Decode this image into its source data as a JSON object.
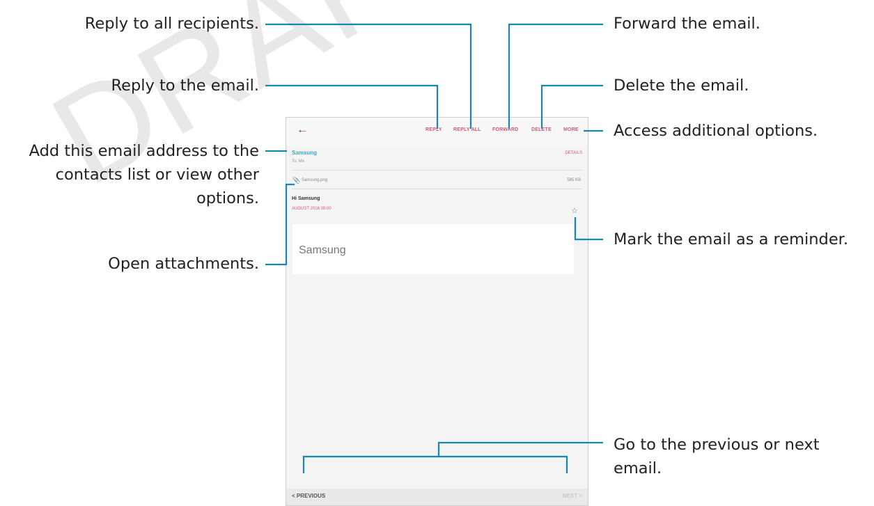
{
  "watermark": "DRAFT",
  "callouts": {
    "reply_all": "Reply to all recipients.",
    "reply": "Reply to the email.",
    "contact_line1": "Add this email address to the",
    "contact_line2": "contacts list or view other",
    "contact_line3": "options.",
    "attachments": "Open attachments.",
    "forward": "Forward the email.",
    "delete": "Delete the email.",
    "more_options": "Access additional options.",
    "reminder": "Mark the email as a reminder.",
    "nav_line1": "Go to the previous or next",
    "nav_line2": "email."
  },
  "device": {
    "back_icon": "arrow-left-icon",
    "actions": {
      "reply": "REPLY",
      "reply_all": "REPLY ALL",
      "forward": "FORWARD",
      "delete": "DELETE",
      "more": "MORE"
    },
    "sender": "Samsung",
    "to": "To: Me",
    "details": "DETAILS",
    "attachment_name": "Samsung.png",
    "attachment_size": "585 KB",
    "subject": "Hi Samsung",
    "date": "AUGUST 2016 09:00",
    "body": "Samsung",
    "prev_label": "< PREVIOUS",
    "next_label": "NEXT >"
  },
  "colors": {
    "accent": "#d25a6a",
    "sender": "#3aa7c8",
    "callout_line": "#1587b5"
  }
}
